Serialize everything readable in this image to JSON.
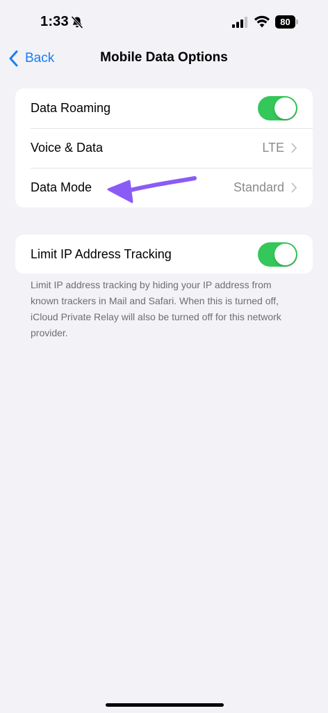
{
  "status_bar": {
    "time": "1:33",
    "battery_level": "80"
  },
  "nav": {
    "back_label": "Back",
    "title": "Mobile Data Options"
  },
  "group1": {
    "rows": [
      {
        "label": "Data Roaming",
        "toggle_on": true
      },
      {
        "label": "Voice & Data",
        "value": "LTE"
      },
      {
        "label": "Data Mode",
        "value": "Standard"
      }
    ]
  },
  "group2": {
    "rows": [
      {
        "label": "Limit IP Address Tracking",
        "toggle_on": true
      }
    ],
    "footnote": "Limit IP address tracking by hiding your IP address from known trackers in Mail and Safari. When this is turned off, iCloud Private Relay will also be turned off for this network provider."
  },
  "colors": {
    "accent": "#1a7cf5",
    "toggle_on": "#34c759",
    "annotation_arrow": "#8a5cf6",
    "background": "#f2f2f7"
  },
  "icons": [
    "bell-slash-icon",
    "cellular-signal-icon",
    "wifi-icon",
    "battery-icon",
    "back-chevron-icon",
    "chevron-right-icon"
  ]
}
